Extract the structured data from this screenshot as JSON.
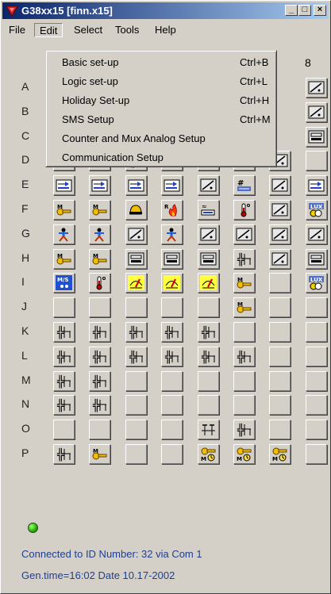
{
  "window": {
    "title": "G38xx15 [finn.x15]",
    "minimize_label": "_",
    "maximize_label": "□",
    "close_label": "×"
  },
  "menu": [
    {
      "label": "File"
    },
    {
      "label": "Edit"
    },
    {
      "label": "Select"
    },
    {
      "label": "Tools"
    },
    {
      "label": "Help"
    }
  ],
  "edit_menu": [
    {
      "label": "Basic set-up",
      "shortcut": "Ctrl+B"
    },
    {
      "label": "Logic set-up",
      "shortcut": "Ctrl+L"
    },
    {
      "label": "Holiday Set-up",
      "shortcut": "Ctrl+H"
    },
    {
      "label": "SMS Setup",
      "shortcut": "Ctrl+M"
    },
    {
      "label": "Counter and Mux Analog Setup",
      "shortcut": ""
    },
    {
      "label": "Communication Setup",
      "shortcut": ""
    }
  ],
  "grid": {
    "visible_column_label": "8",
    "rows": [
      "A",
      "B",
      "C",
      "D",
      "E",
      "F",
      "G",
      "H",
      "I",
      "J",
      "K",
      "L",
      "M",
      "N",
      "O",
      "P"
    ],
    "cells": [
      [
        "hidden",
        "hidden",
        "hidden",
        "hidden",
        "hidden",
        "hidden",
        "hidden",
        "switch"
      ],
      [
        "hidden",
        "hidden",
        "hidden",
        "hidden",
        "hidden",
        "hidden",
        "hidden",
        "switch"
      ],
      [
        "hidden",
        "hidden",
        "hidden",
        "hidden",
        "hidden",
        "hidden",
        "hidden",
        "window"
      ],
      [
        "switch",
        "switch",
        "relay",
        "switch",
        "switch",
        "empty",
        "switch",
        "empty"
      ],
      [
        "dimmer",
        "dimmer",
        "dimmer",
        "dimmer",
        "switch",
        "keypad",
        "switch",
        "dimmer"
      ],
      [
        "key",
        "key",
        "helmet",
        "fire",
        "wave",
        "thermo",
        "switch",
        "lux"
      ],
      [
        "person",
        "person",
        "switch",
        "person",
        "switch",
        "switch",
        "switch",
        "switch"
      ],
      [
        "key",
        "key",
        "window",
        "window",
        "window",
        "relay",
        "switch",
        "window"
      ],
      [
        "ms",
        "thermo",
        "meter",
        "meter",
        "meter",
        "key",
        "empty",
        "lux"
      ],
      [
        "empty",
        "empty",
        "empty",
        "empty",
        "empty",
        "key",
        "empty",
        "empty"
      ],
      [
        "relay",
        "relay",
        "relay",
        "relay",
        "relay",
        "empty",
        "empty",
        "empty"
      ],
      [
        "relay",
        "relay",
        "relay",
        "relay",
        "relay",
        "relay",
        "empty",
        "empty"
      ],
      [
        "relay",
        "relay",
        "empty",
        "empty",
        "empty",
        "empty",
        "empty",
        "empty"
      ],
      [
        "relay",
        "relay",
        "empty",
        "empty",
        "empty",
        "empty",
        "empty",
        "empty"
      ],
      [
        "empty",
        "empty",
        "empty",
        "empty",
        "relay2",
        "relay",
        "empty",
        "empty"
      ],
      [
        "relay",
        "key",
        "empty",
        "empty",
        "keyclock",
        "keyclock",
        "keyclock",
        "empty"
      ]
    ]
  },
  "status": {
    "connected": "Connected to ID Number:  32  via Com  1",
    "gen_time": "Gen.time=16:02  Date  10.17-2002",
    "led_color": "#22b000"
  },
  "colors": {
    "title_start": "#0a246a",
    "title_end": "#a6caf0",
    "face": "#d4d0c8",
    "status_text": "#1f3f8f"
  }
}
